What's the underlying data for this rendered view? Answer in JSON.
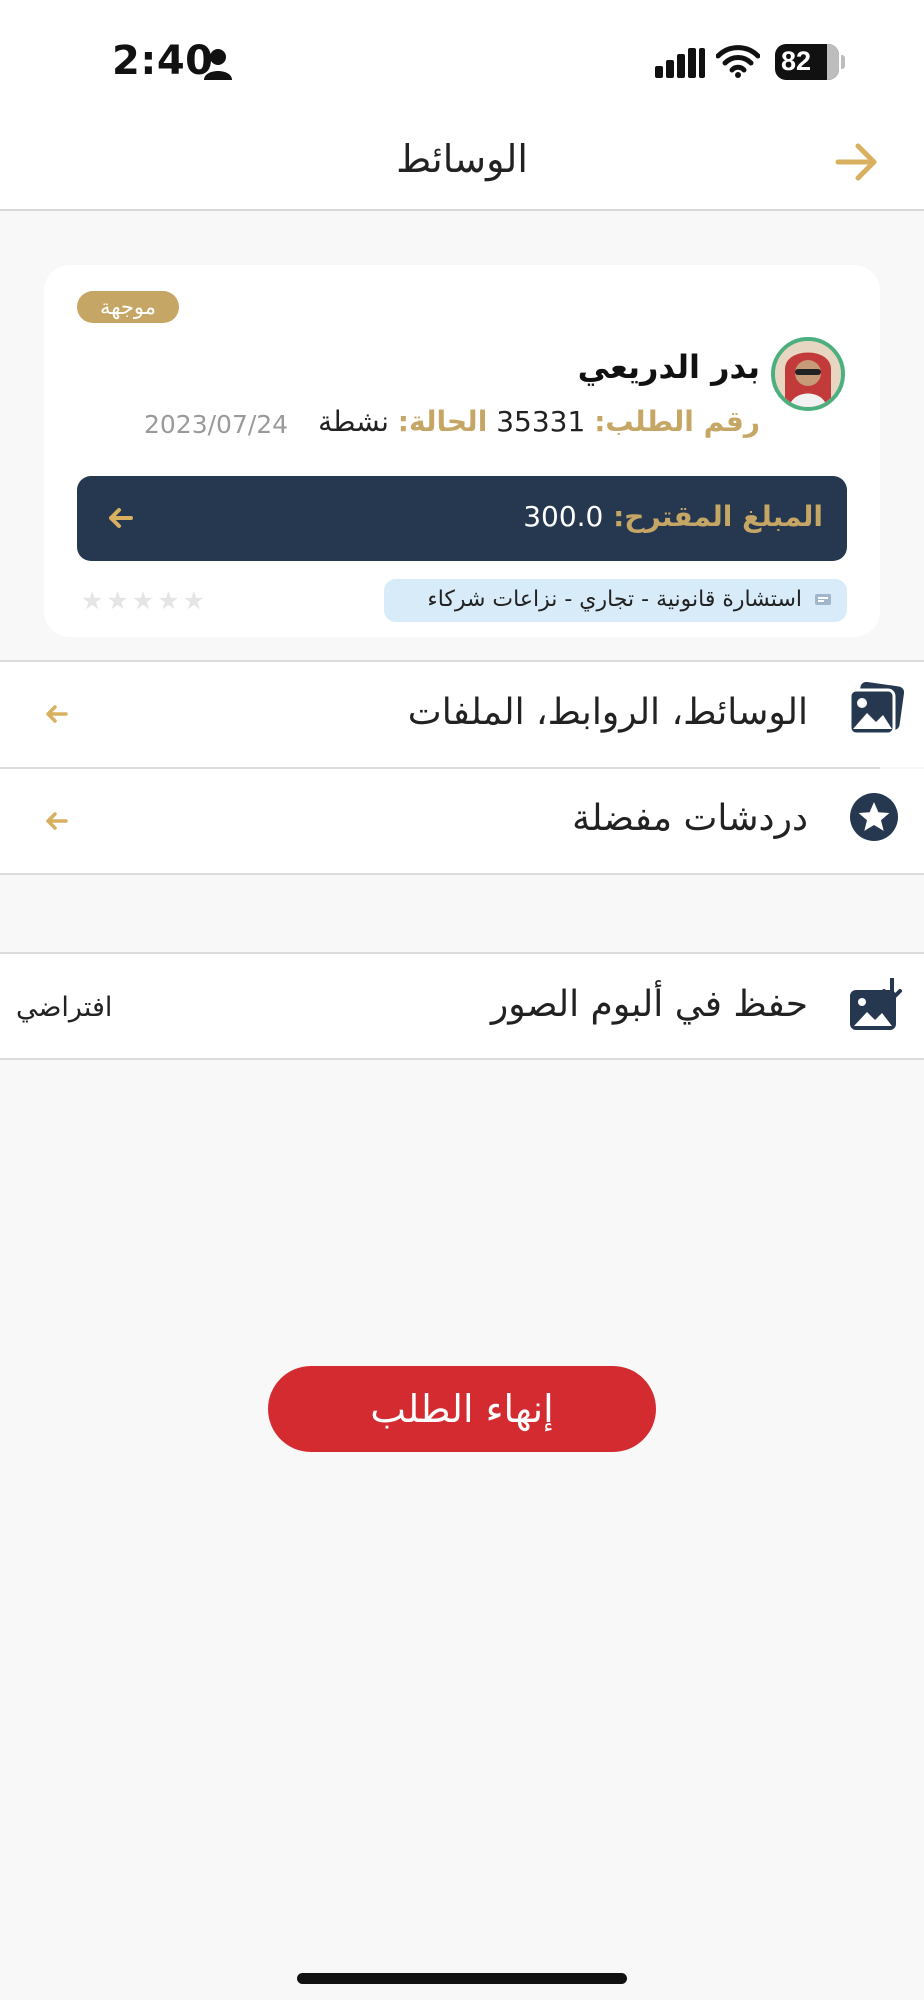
{
  "status_bar": {
    "time": "2:40",
    "battery": "82"
  },
  "header": {
    "title": "الوسائط"
  },
  "request_card": {
    "badge": "موجهة",
    "client_name": "بدر الدريعي",
    "request_number_label": "رقم الطلب:",
    "request_number": "35331",
    "status_label": "الحالة:",
    "status_value": "نشطة",
    "date": "2023/07/24",
    "amount_label": "المبلغ المقترح:",
    "amount_value": "300.0",
    "stars": "★★★★★",
    "rating": 0,
    "tag": "استشارة قانونية - تجاري - نزاعات شركاء"
  },
  "menu": {
    "media_links_files": "الوسائط، الروابط، الملفات",
    "favorite_chats": "دردشات مفضلة",
    "save_to_album": "حفظ في ألبوم الصور",
    "save_to_album_value": "افتراضي"
  },
  "actions": {
    "end_request": "إنهاء الطلب"
  },
  "colors": {
    "gold": "#c6a664",
    "navy": "#253850",
    "red": "#d42b31",
    "chip": "#d8ebf8"
  }
}
